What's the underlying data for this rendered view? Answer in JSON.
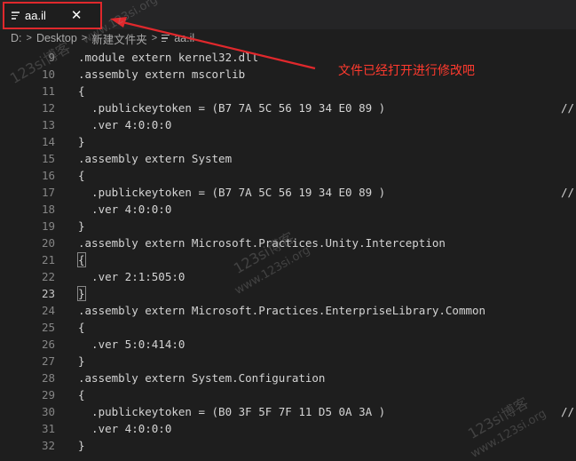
{
  "tab": {
    "title": "aa.il",
    "close_glyph": "✕",
    "icon": "file-lines-icon"
  },
  "breadcrumb": {
    "items": [
      "D:",
      "Desktop",
      "新建文件夹",
      "aa.il"
    ],
    "separator": ">"
  },
  "annotation": {
    "text": "文件已经打开进行修改吧",
    "color": "#ff3a2e"
  },
  "watermarks": [
    "123si博客",
    "www.123si.org"
  ],
  "editor": {
    "active_line": 23,
    "lines": [
      {
        "n": "9",
        "code": ".module extern kernel32.dll",
        "comment": ""
      },
      {
        "n": "10",
        "code": ".assembly extern mscorlib",
        "comment": ""
      },
      {
        "n": "11",
        "code": "{",
        "comment": ""
      },
      {
        "n": "12",
        "code": "  .publickeytoken = (B7 7A 5C 56 19 34 E0 89 )",
        "comment": "//"
      },
      {
        "n": "13",
        "code": "  .ver 4:0:0:0",
        "comment": ""
      },
      {
        "n": "14",
        "code": "}",
        "comment": ""
      },
      {
        "n": "15",
        "code": ".assembly extern System",
        "comment": ""
      },
      {
        "n": "16",
        "code": "{",
        "comment": ""
      },
      {
        "n": "17",
        "code": "  .publickeytoken = (B7 7A 5C 56 19 34 E0 89 )",
        "comment": "//"
      },
      {
        "n": "18",
        "code": "  .ver 4:0:0:0",
        "comment": ""
      },
      {
        "n": "19",
        "code": "}",
        "comment": ""
      },
      {
        "n": "20",
        "code": ".assembly extern Microsoft.Practices.Unity.Interception",
        "comment": ""
      },
      {
        "n": "21",
        "code": "{",
        "comment": ""
      },
      {
        "n": "22",
        "code": "  .ver 2:1:505:0",
        "comment": ""
      },
      {
        "n": "23",
        "code": "}",
        "comment": ""
      },
      {
        "n": "24",
        "code": ".assembly extern Microsoft.Practices.EnterpriseLibrary.Common",
        "comment": ""
      },
      {
        "n": "25",
        "code": "{",
        "comment": ""
      },
      {
        "n": "26",
        "code": "  .ver 5:0:414:0",
        "comment": ""
      },
      {
        "n": "27",
        "code": "}",
        "comment": ""
      },
      {
        "n": "28",
        "code": ".assembly extern System.Configuration",
        "comment": ""
      },
      {
        "n": "29",
        "code": "{",
        "comment": ""
      },
      {
        "n": "30",
        "code": "  .publickeytoken = (B0 3F 5F 7F 11 D5 0A 3A )",
        "comment": "//"
      },
      {
        "n": "31",
        "code": "  .ver 4:0:0:0",
        "comment": ""
      },
      {
        "n": "32",
        "code": "}",
        "comment": ""
      }
    ],
    "matched_bracket_lines": [
      21,
      23
    ]
  }
}
